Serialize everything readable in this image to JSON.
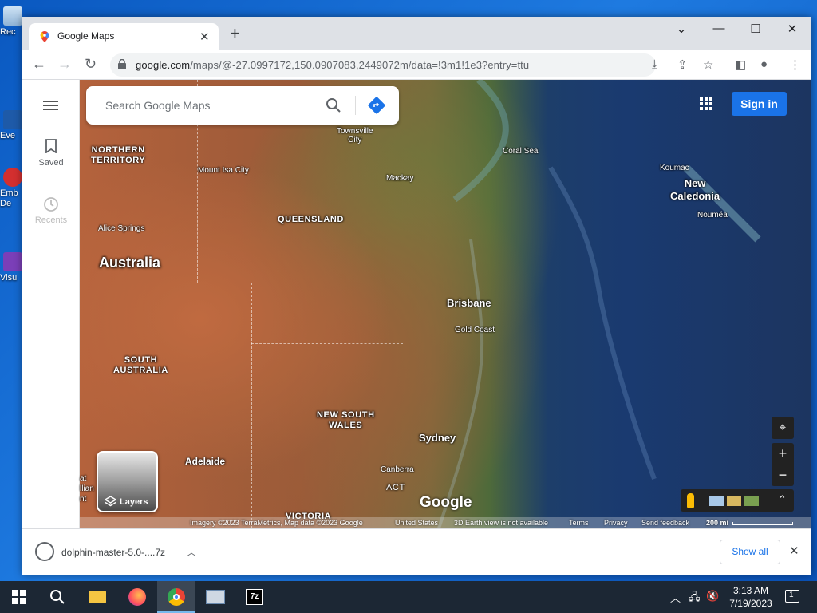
{
  "desktop": {
    "icons": [
      {
        "label": "Rec"
      },
      {
        "label": "Eve"
      },
      {
        "label": "Emb\nDe"
      },
      {
        "label": "Visu"
      }
    ]
  },
  "browser": {
    "tab_title": "Google Maps",
    "url_host": "google.com",
    "url_path": "/maps/@-27.0997172,150.0907083,2449072m/data=!3m1!1e3?entry=ttu"
  },
  "maps": {
    "search_placeholder": "Search Google Maps",
    "sidebar": {
      "saved_label": "Saved",
      "recents_label": "Recents"
    },
    "signin_label": "Sign in",
    "layers_label": "Layers",
    "logo": "Google",
    "labels": {
      "country": "Australia",
      "northern_territory": "NORTHERN\nTERRITORY",
      "queensland": "QUEENSLAND",
      "south_australia": "SOUTH\nAUSTRALIA",
      "new_south_wales": "NEW SOUTH\nWALES",
      "victoria": "VICTORIA",
      "act": "ACT",
      "townsville": "Townsville\nCity",
      "mount_isa": "Mount Isa City",
      "mackay": "Mackay",
      "alice_springs": "Alice Springs",
      "brisbane": "Brisbane",
      "gold_coast": "Gold Coast",
      "sydney": "Sydney",
      "adelaide": "Adelaide",
      "canberra": "Canberra",
      "coral_sea": "Coral Sea",
      "koumac": "Koumac",
      "new_caledonia": "New\nCaledonia",
      "noumea": "Nouméa",
      "left_cut_1": "at",
      "left_cut_2": "llian",
      "left_cut_3": "nt"
    },
    "footer": {
      "imagery": "Imagery ©2023 TerraMetrics, Map data ©2023 Google",
      "country": "United States",
      "earth": "3D Earth view is not available",
      "terms": "Terms",
      "privacy": "Privacy",
      "feedback": "Send feedback",
      "scale": "200 mi"
    }
  },
  "downloads": {
    "file_name": "dolphin-master-5.0-....7z",
    "show_all": "Show all"
  },
  "taskbar": {
    "time": "3:13 AM",
    "date": "7/19/2023",
    "notification_count": "1"
  },
  "colors": {
    "accent": "#1a73e8",
    "taskbar": "#1c2734"
  }
}
